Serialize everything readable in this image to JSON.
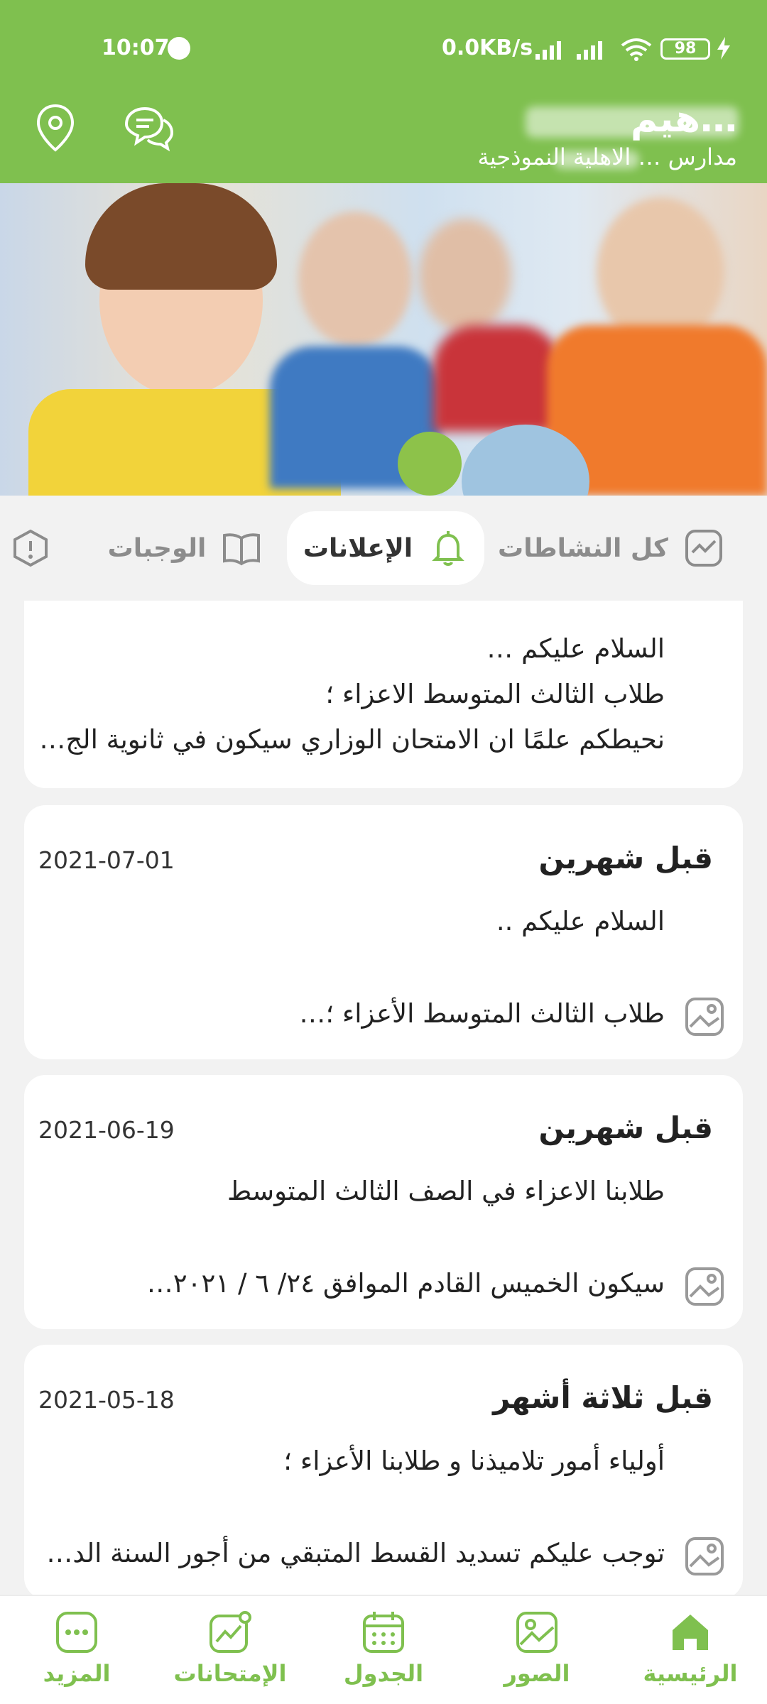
{
  "status_bar": {
    "time": "10:07",
    "net_speed": "0.0KB/s",
    "battery": "98"
  },
  "header": {
    "school_name": "…هيم",
    "school_subtitle": "مدارس … الاهلية النموذجية"
  },
  "tabs": [
    {
      "label": "كل النشاطات",
      "icon": "activity-icon",
      "active": false
    },
    {
      "label": "الإعلانات",
      "icon": "bell-icon",
      "active": true
    },
    {
      "label": "الوجبات",
      "icon": "book-icon",
      "active": false
    }
  ],
  "cards": [
    {
      "lines": [
        "السلام عليكم …",
        "طلاب الثالث المتوسط الاعزاء ؛",
        "نحيطكم علمًا ان الامتحان الوزاري سيكون في ثانوية الج…"
      ]
    },
    {
      "time_ago": "قبل شهرين",
      "date": "2021-07-01",
      "line1": "السلام عليكم ..",
      "line2": "طلاب الثالث المتوسط الأعزاء ؛…"
    },
    {
      "time_ago": "قبل شهرين",
      "date": "2021-06-19",
      "line1": "طلابنا الاعزاء في الصف الثالث المتوسط",
      "line2": "سيكون الخميس القادم الموافق ٢٤/ ٦ / ٢٠٢١…"
    },
    {
      "time_ago": "قبل ثلاثة أشهر",
      "date": "2021-05-18",
      "line1": "أولياء أمور تلاميذنا و طلابنا الأعزاء ؛",
      "line2": "توجب عليكم تسديد القسط المتبقي من أجور السنة الد…"
    }
  ],
  "bottom_nav": [
    {
      "label": "الرئيسية",
      "icon": "home-icon"
    },
    {
      "label": "الصور",
      "icon": "photos-icon"
    },
    {
      "label": "الجدول",
      "icon": "calendar-icon"
    },
    {
      "label": "الإمتحانات",
      "icon": "chart-icon"
    },
    {
      "label": "المزيد",
      "icon": "more-icon"
    }
  ],
  "colors": {
    "brand_green": "#7fc04f",
    "background": "#f2f2f2"
  }
}
